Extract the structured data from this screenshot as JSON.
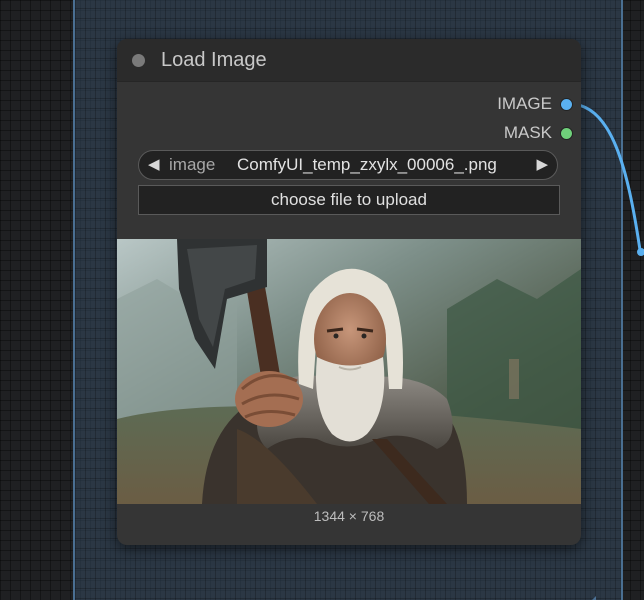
{
  "node": {
    "title": "Load Image",
    "outputs": [
      {
        "label": "IMAGE",
        "color": "#5ab0f0"
      },
      {
        "label": "MASK",
        "color": "#6fd07a"
      }
    ],
    "image_widget": {
      "label": "image",
      "value": "ComfyUI_temp_zxylx_00006_.png"
    },
    "upload_label": "choose file to upload",
    "preview_dimensions": "1344 × 768"
  },
  "colors": {
    "link": "#5ab0f0",
    "group_border": "#4a6f92",
    "node_body": "#353535"
  },
  "icons": {
    "prev": "triangle-left-icon",
    "next": "triangle-right-icon"
  }
}
